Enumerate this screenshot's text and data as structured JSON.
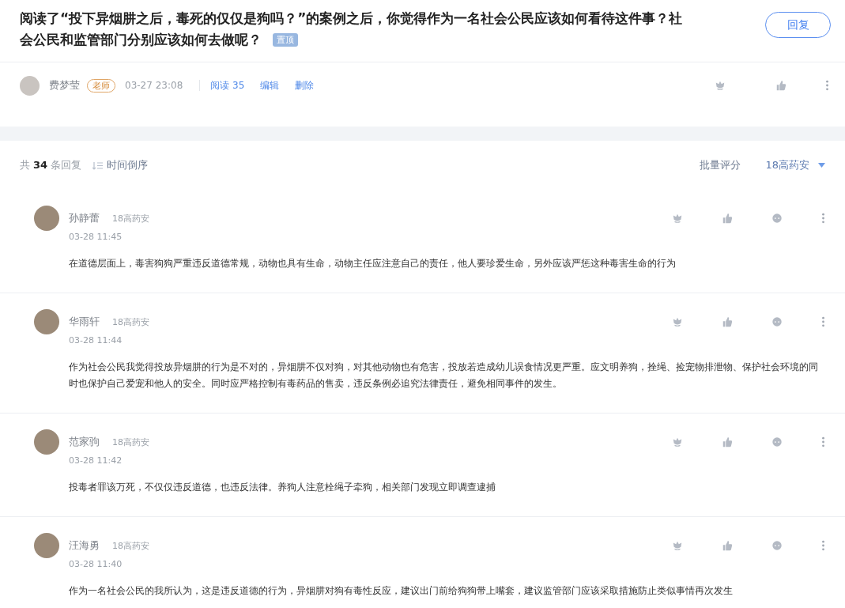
{
  "post": {
    "title": "阅读了“投下异烟肼之后，毒死的仅仅是狗吗？”的案例之后，你觉得作为一名社会公民应该如何看待这件事？社会公民和监管部门分别应该如何去做呢？",
    "pinned_tag": "置顶",
    "reply_button": "回复",
    "author": "费梦莹",
    "role_tag": "老师",
    "time": "03-27 23:08",
    "reads": "阅读 35",
    "edit": "编辑",
    "delete": "删除"
  },
  "replies_bar": {
    "prefix": "共",
    "count": "34",
    "suffix": "条回复",
    "sort": "时间倒序",
    "batch_grade": "批量评分",
    "class_filter": "18高药安"
  },
  "comments": [
    {
      "name": "孙静蕾",
      "class": "18高药安",
      "time": "03-28 11:45",
      "text": "在道德层面上，毒害狗狗严重违反道德常规，动物也具有生命，动物主任应注意自己的责任，他人要珍爱生命，另外应该严惩这种毒害生命的行为"
    },
    {
      "name": "华雨轩",
      "class": "18高药安",
      "time": "03-28 11:44",
      "text": "作为社会公民我觉得投放异烟肼的行为是不对的，异烟肼不仅对狗，对其他动物也有危害，投放若造成幼儿误食情况更严重。应文明养狗，拴绳、捡宠物排泄物、保护社会环境的同时也保护自己爱宠和他人的安全。同时应严格控制有毒药品的售卖，违反条例必追究法律责任，避免相同事件的发生。"
    },
    {
      "name": "范家驹",
      "class": "18高药安",
      "time": "03-28 11:42",
      "text": "投毒者罪该万死，不仅仅违反道德，也违反法律。养狗人注意栓绳子牵狗，相关部门发现立即调查逮捕"
    },
    {
      "name": "汪海勇",
      "class": "18高药安",
      "time": "03-28 11:40",
      "text": "作为一名社会公民的我所认为，这是违反道德的行为，异烟肼对狗有毒性反应，建议出门前给狗狗带上嘴套，建议监管部门应该采取措施防止类似事情再次发生"
    }
  ]
}
